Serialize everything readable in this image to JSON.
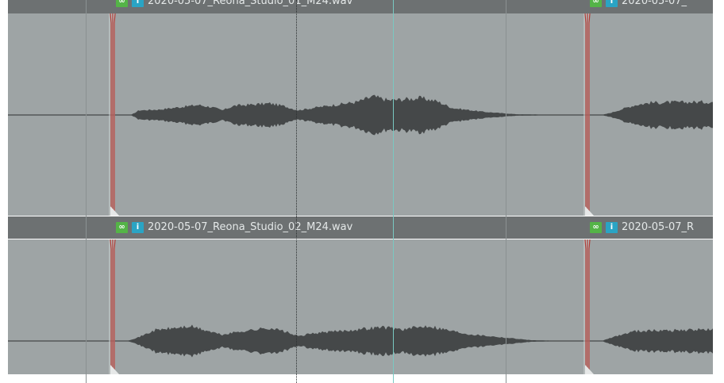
{
  "tracks": [
    {
      "clips": [
        {
          "filename": "2020-05-07_Reona_Studio_01_M24.wav"
        },
        {
          "filename": "2020-05-07_"
        }
      ]
    },
    {
      "clips": [
        {
          "filename": "2020-05-07_Reona_Studio_02_M24.wav"
        },
        {
          "filename": "2020-05-07_R"
        }
      ]
    }
  ],
  "icons": {
    "link": "link-icon",
    "info": "info-icon",
    "info_glyph": "i"
  },
  "colors": {
    "waveform": "#454849",
    "clip_bg": "#9ea4a5",
    "header_bg": "#6d7172",
    "fade_line": "#b13a34",
    "link_icon": "#54b447",
    "info_icon": "#2aa4c4",
    "cursor": "#79c9c2"
  }
}
